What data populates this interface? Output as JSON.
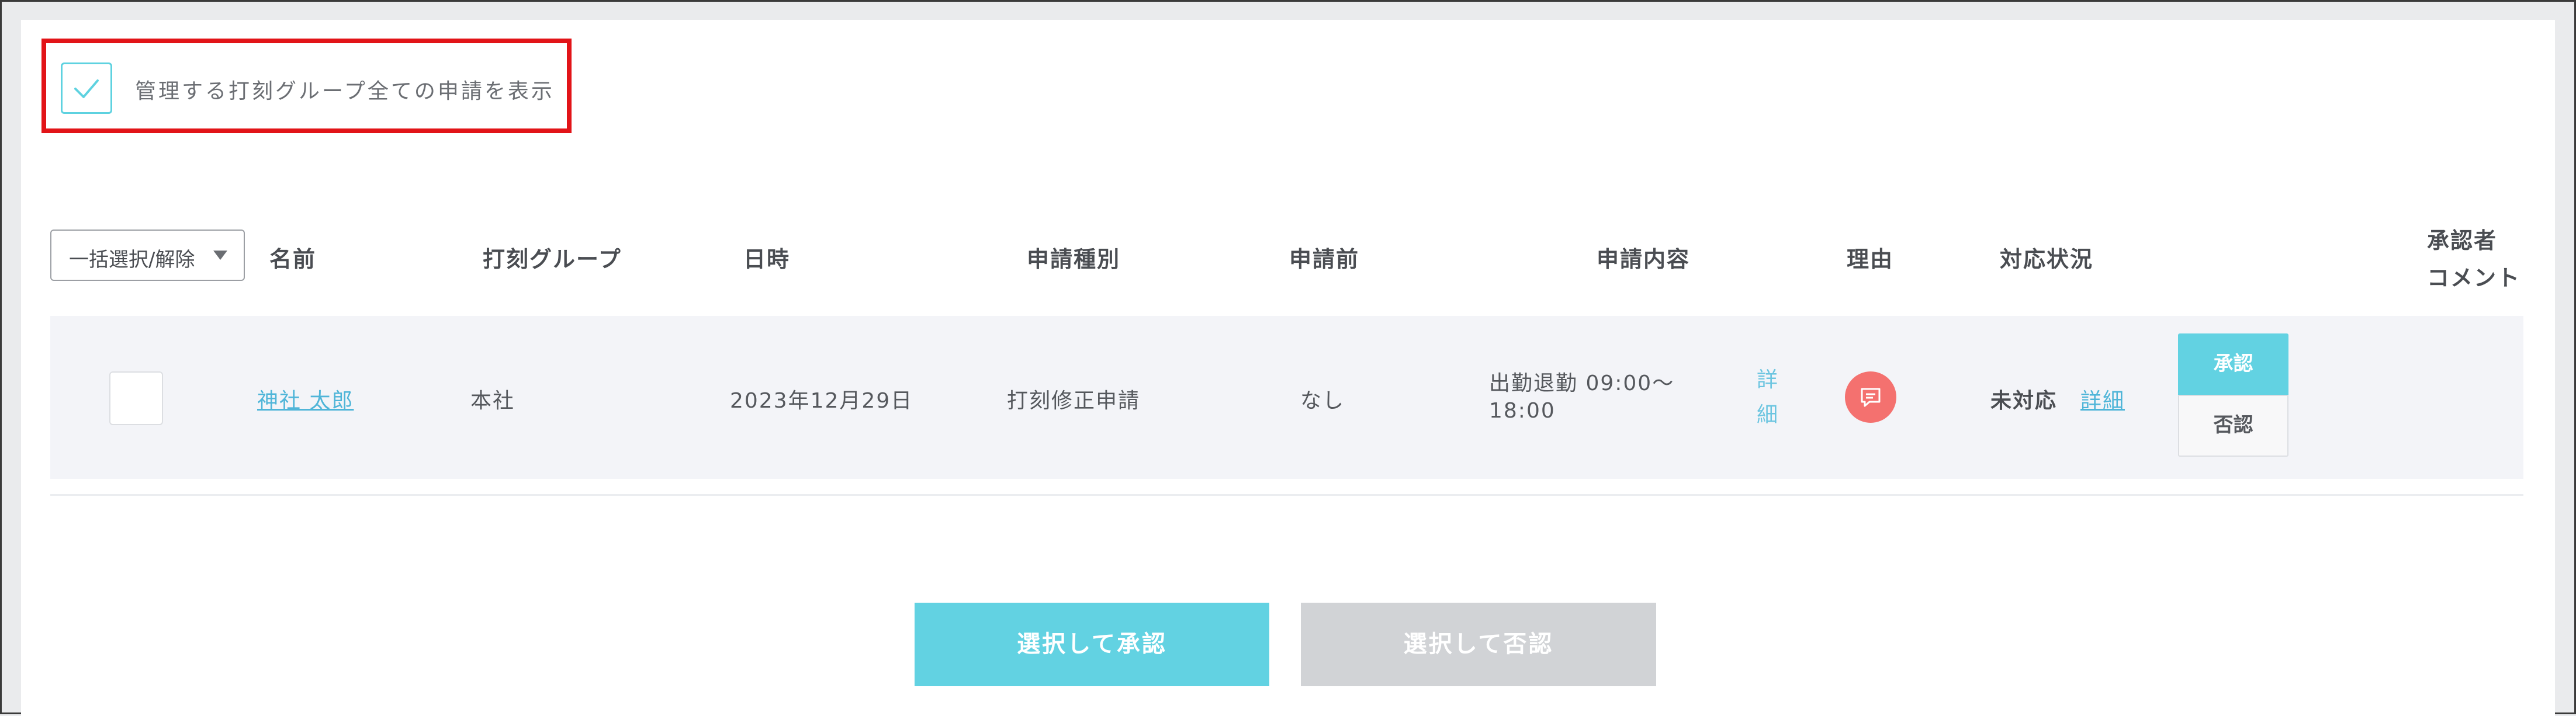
{
  "filter": {
    "show_all_label": "管理する打刻グループ全ての申請を表示",
    "show_all_checked": true
  },
  "table": {
    "bulk_select_label": "一括選択/解除",
    "headers": {
      "name": "名前",
      "group": "打刻グループ",
      "datetime": "日時",
      "request_type": "申請種別",
      "before": "申請前",
      "content": "申請内容",
      "reason": "理由",
      "status": "対応状況",
      "approver_comment_line1": "承認者",
      "approver_comment_line2": "コメント"
    },
    "rows": [
      {
        "name": "神社 太郎",
        "group": "本社",
        "date": "2023年12月29日",
        "request_type": "打刻修正申請",
        "before": "なし",
        "content_line1": "出勤退勤 09:00〜",
        "content_line2": "18:00",
        "content_detail_char1": "詳",
        "content_detail_char2": "細",
        "status": "未対応",
        "status_detail": "詳細",
        "approve_label": "承認",
        "reject_label": "否認"
      }
    ]
  },
  "actions": {
    "approve_selected": "選択して承認",
    "reject_selected": "選択して否認"
  },
  "colors": {
    "accent": "#62d2e2",
    "highlight": "#e21418",
    "reason_icon": "#f4716f",
    "disabled": "#d1d3d6"
  },
  "icons": {
    "checkmark": "check-icon",
    "reason": "comment-icon",
    "dropdown": "caret-down-icon"
  }
}
